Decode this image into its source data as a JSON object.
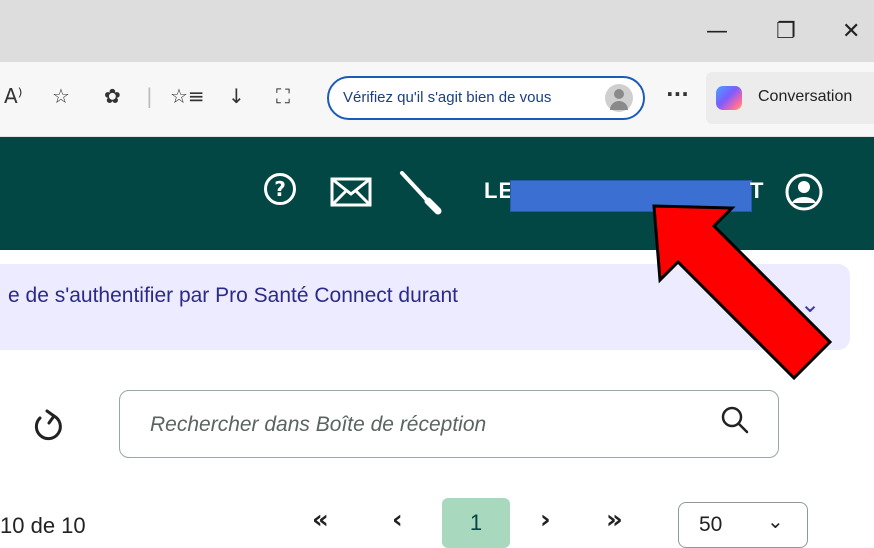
{
  "browser": {
    "window_controls": {
      "minimize": "—",
      "restore": "❐",
      "close": "✕"
    },
    "toolbar": {
      "read_aloud": "A⁾",
      "favorite": "☆",
      "extensions": "✿",
      "favorites_list": "☆≡",
      "downloads": "↓",
      "screenshot": "⛶",
      "verify_label": "Vérifiez qu'il s'agit bien de vous",
      "more": "···",
      "conversation_label": "Conversation"
    }
  },
  "app": {
    "header": {
      "help_glyph": "?",
      "user_prefix": "LE",
      "user_suffix": "T"
    },
    "banner": {
      "text": "e de s'authentifier par Pro Santé Connect durant",
      "chevron": "⌄"
    },
    "search": {
      "placeholder": "Rechercher dans Boîte de réception"
    },
    "pagination": {
      "range_text": "10 de 10",
      "first": "«",
      "prev": "‹",
      "current_page": "1",
      "next": "›",
      "last": "»",
      "page_size": "50",
      "page_size_chevron": "⌄"
    }
  },
  "colors": {
    "header_bg": "#034745",
    "banner_bg": "#edebff",
    "current_page_bg": "#a8d8bd",
    "annotation_arrow": "#ff0000",
    "redaction": "#3b6fd1"
  }
}
